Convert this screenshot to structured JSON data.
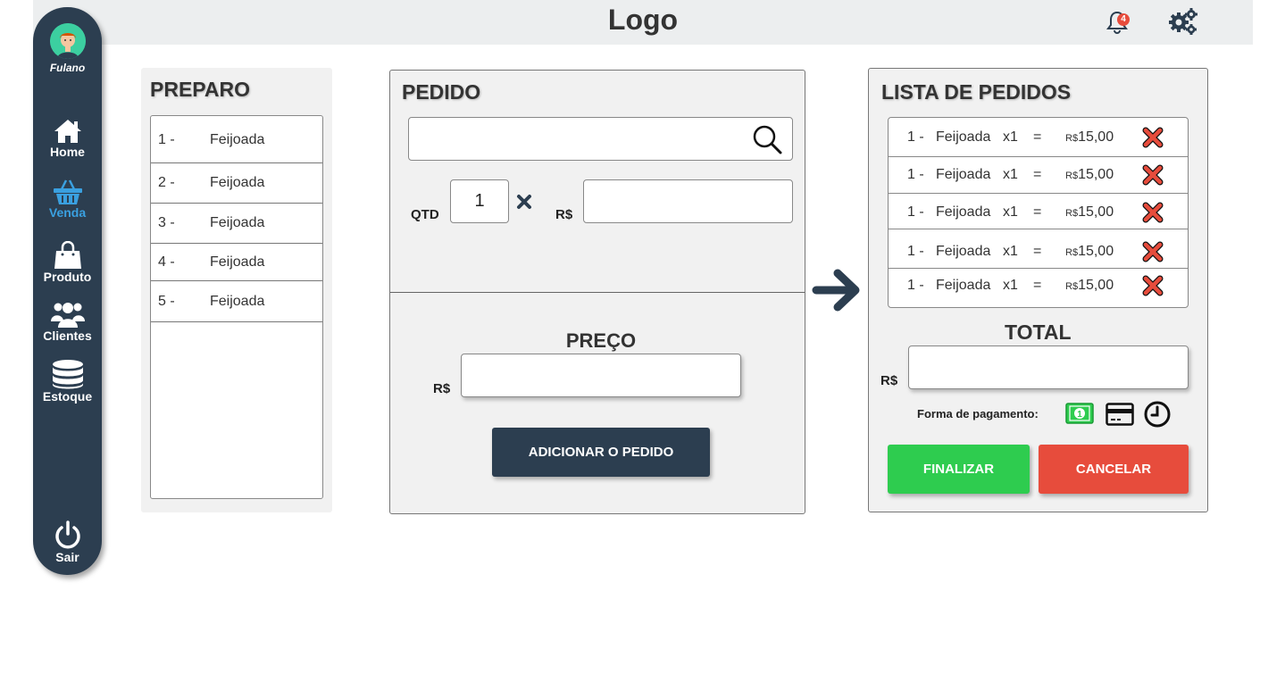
{
  "header": {
    "logo": "Logo",
    "notification_count": "4",
    "icons": [
      "bell-icon",
      "gears-icon"
    ]
  },
  "sidebar": {
    "username": "Fulano",
    "items": [
      {
        "label": "Home",
        "icon": "home-icon",
        "active": false
      },
      {
        "label": "Venda",
        "icon": "basket-icon",
        "active": true
      },
      {
        "label": "Produto",
        "icon": "shopping-bag-icon",
        "active": false
      },
      {
        "label": "Clientes",
        "icon": "users-icon",
        "active": false
      },
      {
        "label": "Estoque",
        "icon": "database-icon",
        "active": false
      }
    ],
    "logout": {
      "label": "Sair",
      "icon": "power-icon"
    }
  },
  "preparo": {
    "title": "PREPARO",
    "items": [
      {
        "num": "1 -",
        "name": "Feijoada"
      },
      {
        "num": "2 -",
        "name": "Feijoada"
      },
      {
        "num": "3 -",
        "name": "Feijoada"
      },
      {
        "num": "4 -",
        "name": "Feijoada"
      },
      {
        "num": "5 -",
        "name": "Feijoada"
      }
    ]
  },
  "pedido": {
    "title": "PEDIDO",
    "search_value": "",
    "qtd_label": "QTD",
    "qtd_value": "1",
    "currency_label": "R$",
    "unit_price_value": "",
    "preco_title": "PREÇO",
    "preco_currency": "R$",
    "preco_value": "",
    "add_button": "ADICIONAR O PEDIDO"
  },
  "lista": {
    "title": "LISTA DE PEDIDOS",
    "orders": [
      {
        "num": "1 -",
        "name": "Feijoada",
        "qty": "x1",
        "eq": "=",
        "cur": "R$",
        "price": "15,00"
      },
      {
        "num": "1 -",
        "name": "Feijoada",
        "qty": "x1",
        "eq": "=",
        "cur": "R$",
        "price": "15,00"
      },
      {
        "num": "1 -",
        "name": "Feijoada",
        "qty": "x1",
        "eq": "=",
        "cur": "R$",
        "price": "15,00"
      },
      {
        "num": "1 -",
        "name": "Feijoada",
        "qty": "x1",
        "eq": "=",
        "cur": "R$",
        "price": "15,00"
      },
      {
        "num": "1 -",
        "name": "Feijoada",
        "qty": "x1",
        "eq": "=",
        "cur": "R$",
        "price": "15,00"
      }
    ],
    "total_title": "TOTAL",
    "total_currency": "R$",
    "total_value": "",
    "payment_label": "Forma de pagamento:",
    "payment_icons": [
      "cash-icon",
      "credit-card-icon",
      "clock-icon"
    ],
    "finalize_button": "FINALIZAR",
    "cancel_button": "CANCELAR"
  },
  "colors": {
    "sidebar": "#2c3e50",
    "active": "#3aa0e0",
    "finalize": "#2ecc4f",
    "cancel": "#e74c3c",
    "cash": "#2ecc4f"
  }
}
